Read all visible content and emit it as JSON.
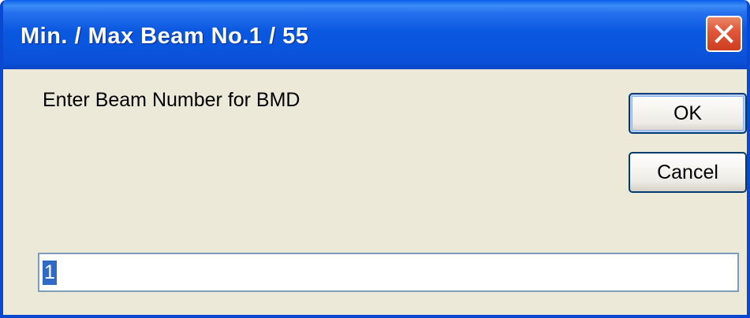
{
  "window": {
    "title": "Min. / Max Beam No.1 / 55"
  },
  "dialog": {
    "prompt": "Enter Beam Number for BMD",
    "ok_label": "OK",
    "cancel_label": "Cancel",
    "input_value": "1"
  },
  "icons": {
    "close": "close-icon"
  },
  "colors": {
    "titlebar": "#0A55DD",
    "dialog_background": "#ECE9D8",
    "close_button": "#E0593A",
    "selection": "#316AC5"
  }
}
